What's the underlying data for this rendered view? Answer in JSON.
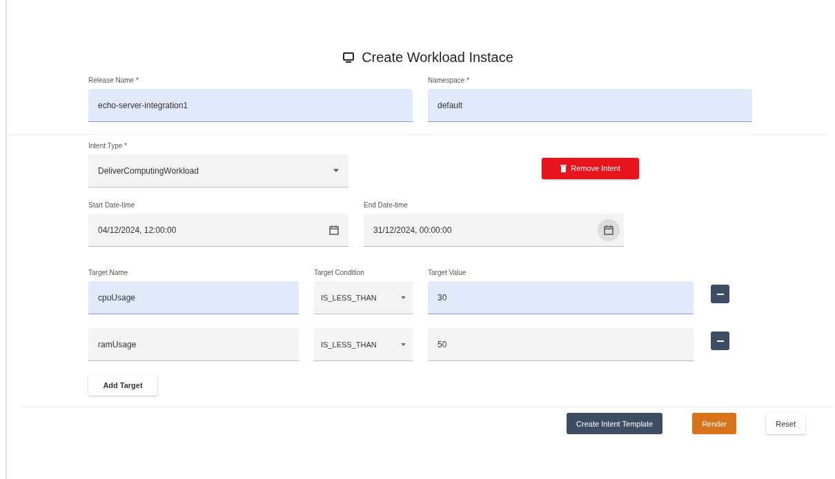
{
  "title": "Create Workload Instace",
  "release": {
    "label": "Release Name *",
    "value": "echo-server-integration1",
    "autofilled": true
  },
  "namespace": {
    "label": "Namespace *",
    "value": "default",
    "autofilled": true
  },
  "intent_type": {
    "label": "Intent Type *",
    "value": "DeliverComputingWorkload"
  },
  "remove_button": "Remove Intent",
  "start": {
    "label": "Start Date-time",
    "value": "04/12/2024, 12:00:00"
  },
  "end": {
    "label": "End Date-time",
    "value": "31/12/2024, 00:00:00"
  },
  "target_headers": [
    "Target Name",
    "Target Condition",
    "Target Value"
  ],
  "targets": [
    {
      "name": "cpuUsage",
      "condition": "IS_LESS_THAN",
      "value": "30",
      "autofilled": true
    },
    {
      "name": "ramUsage",
      "condition": "IS_LESS_THAN",
      "value": "50",
      "autofilled": false
    }
  ],
  "add_target": "Add Target",
  "actions": [
    {
      "label": "Create Intent Template",
      "kind": "primary"
    },
    {
      "label": "Render",
      "kind": "warning"
    },
    {
      "label": "Reset",
      "kind": "plain"
    }
  ]
}
